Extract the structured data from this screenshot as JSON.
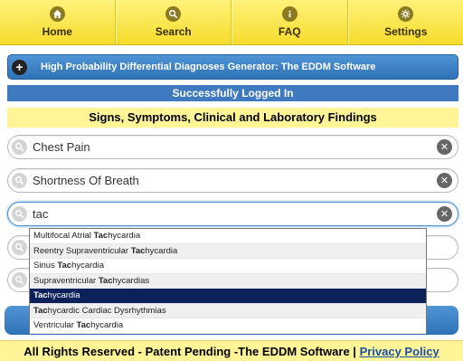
{
  "nav": {
    "items": [
      {
        "label": "Home",
        "icon": "home-icon"
      },
      {
        "label": "Search",
        "icon": "search-icon"
      },
      {
        "label": "FAQ",
        "icon": "info-icon"
      },
      {
        "label": "Settings",
        "icon": "gear-icon"
      }
    ]
  },
  "header": {
    "title": "High Probability Differential Diagnoses Generator: The EDDM Software"
  },
  "status": "Successfully Logged In",
  "section_heading": "Signs, Symptoms, Clinical and Laboratory Findings",
  "fields": [
    {
      "value": "Chest Pain"
    },
    {
      "value": "Shortness Of Breath"
    },
    {
      "value": "tac"
    }
  ],
  "suggestions": [
    {
      "pre": "Multifocal Atrial ",
      "match": "Tac",
      "post": "hycardia"
    },
    {
      "pre": "Reentry Supraventricular ",
      "match": "Tac",
      "post": "hycardia"
    },
    {
      "pre": "Sinus ",
      "match": "Tac",
      "post": "hycardia"
    },
    {
      "pre": "Supraventricular ",
      "match": "Tac",
      "post": "hycardias"
    },
    {
      "pre": "",
      "match": "Tac",
      "post": "hycardia",
      "selected": true
    },
    {
      "pre": "",
      "match": "Tac",
      "post": "hycardic Cardiac Dysrhythmias"
    },
    {
      "pre": "Ventricular ",
      "match": "Tac",
      "post": "hycardia"
    }
  ],
  "footer": {
    "text": "All Rights Reserved - Patent Pending -The EDDM Software | ",
    "link": "Privacy Policy"
  },
  "colors": {
    "nav_bg": "#f6dc2c",
    "header_blue": "#2f72b7",
    "selected_row": "#0a2259",
    "footer_bg": "#fff596"
  }
}
